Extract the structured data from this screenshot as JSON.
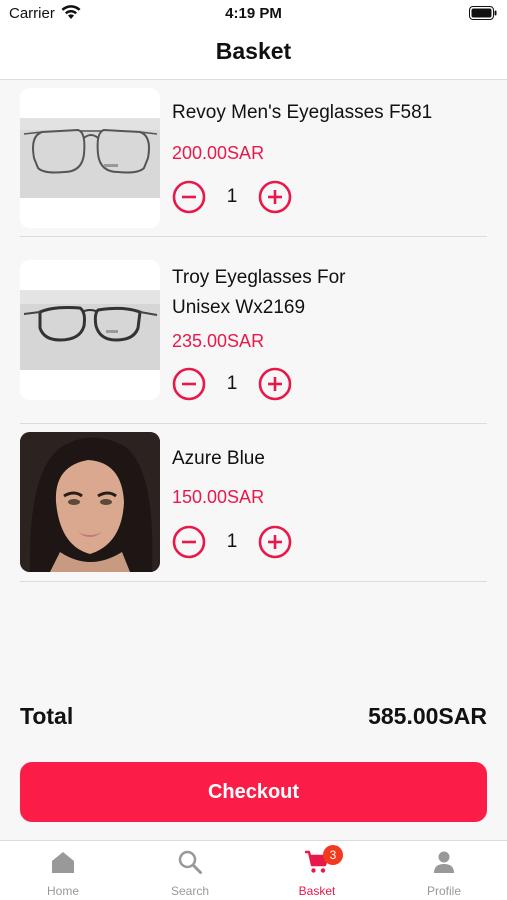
{
  "status": {
    "carrier": "Carrier",
    "time": "4:19 PM"
  },
  "header": {
    "title": "Basket"
  },
  "items": [
    {
      "name_line1": "Revoy Men's Eyeglasses F581",
      "name_line2": "",
      "price": "200.00SAR",
      "quantity": "1",
      "image": "eyeglasses-image"
    },
    {
      "name_line1": "Troy Eyeglasses For",
      "name_line2": "Unisex Wx2169",
      "price": "235.00SAR",
      "quantity": "1",
      "image": "eyeglasses-image"
    },
    {
      "name_line1": "Azure Blue",
      "name_line2": "",
      "price": "150.00SAR",
      "quantity": "1",
      "image": "model-portrait-image"
    }
  ],
  "summary": {
    "total_label": "Total",
    "total_value": "585.00SAR"
  },
  "checkout": {
    "label": "Checkout"
  },
  "tabs": [
    {
      "label": "Home",
      "icon": "home-icon"
    },
    {
      "label": "Search",
      "icon": "search-icon"
    },
    {
      "label": "Basket",
      "icon": "cart-icon",
      "badge": "3",
      "active": true
    },
    {
      "label": "Profile",
      "icon": "person-icon"
    }
  ],
  "colors": {
    "accent": "#e8194a",
    "checkout": "#fb1c47",
    "badge": "#f43a1e"
  }
}
